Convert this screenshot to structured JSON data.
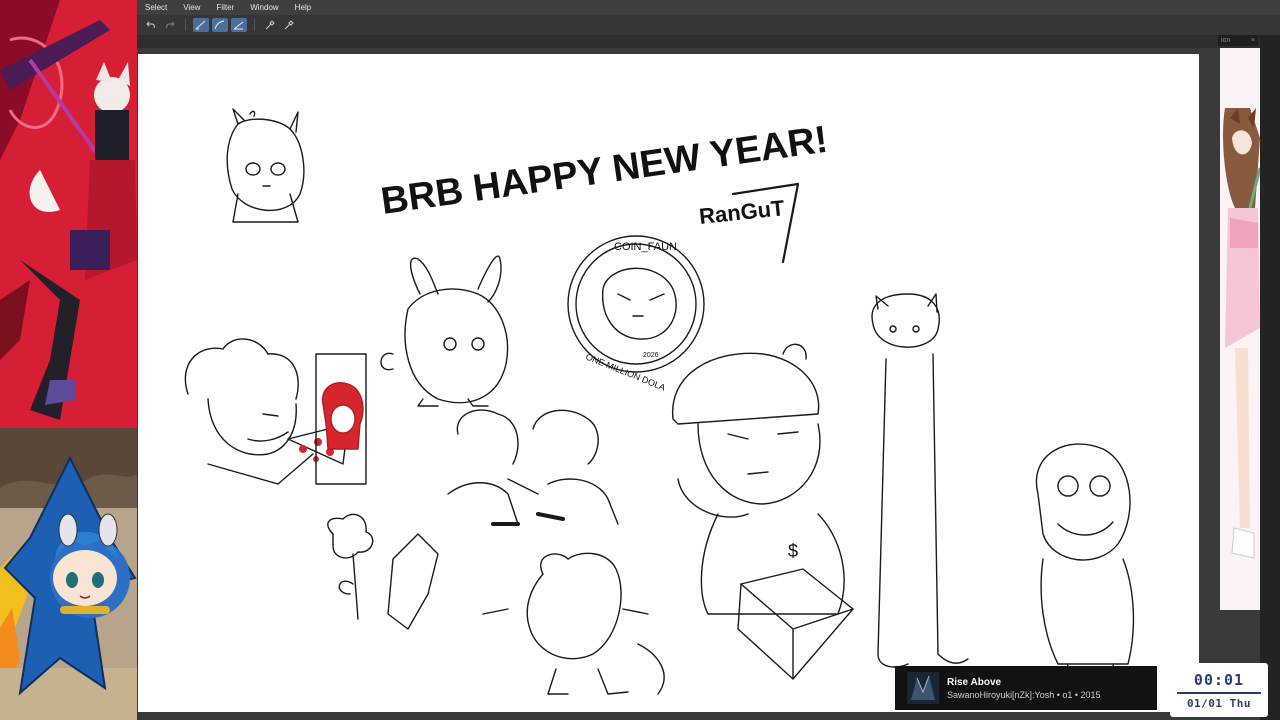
{
  "menubar": {
    "items": [
      {
        "label": "Select"
      },
      {
        "label": "View"
      },
      {
        "label": "Filter"
      },
      {
        "label": "Window"
      },
      {
        "label": "Help"
      }
    ]
  },
  "toolbar": {
    "icons": [
      "undo-icon",
      "redo-icon",
      "pen-line-icon",
      "pen-curve-icon",
      "pen-stroke-icon",
      "eyedropper-icon",
      "eyedropper-alt-icon"
    ]
  },
  "right_tab": {
    "label": "ion",
    "close": "×"
  },
  "canvas": {
    "headline": "BRB HAPPY NEW YEAR!",
    "signature": "RanGuT",
    "coin": {
      "top_text": "COIN_FAUN",
      "bottom_text": "ONE MILLION DOLA",
      "year": "2026"
    }
  },
  "now_playing": {
    "title": "Rise Above",
    "meta": "SawanoHiroyuki[nZk]:Yosh • o1 • 2015"
  },
  "clock": {
    "time": "00:01",
    "date": "01/01 Thu"
  },
  "colors": {
    "canvas_bg": "#ffffff",
    "menubar_bg": "#3f3f3f",
    "accent": "#4c6f99",
    "clock_text": "#2a3f6e",
    "left_art_red": "#d61e34"
  }
}
